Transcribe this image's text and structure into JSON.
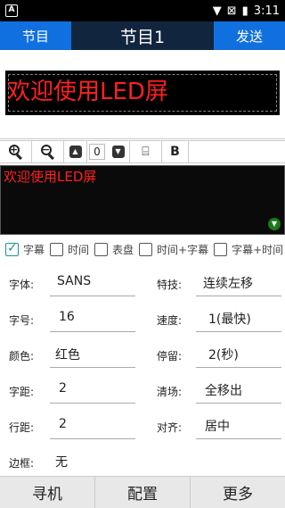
{
  "status": {
    "app_icon": "A",
    "time": "3:11"
  },
  "appbar": {
    "left_label": "节目",
    "title": "节目1",
    "right_label": "发送"
  },
  "preview": {
    "text": "欢迎使用LED屏",
    "text_color": "#ff2020"
  },
  "toolbar": {
    "number_value": "0",
    "bold_label": "B"
  },
  "editor": {
    "text": "欢迎使用LED屏"
  },
  "checkboxes": [
    {
      "label": "字幕",
      "checked": true
    },
    {
      "label": "时间",
      "checked": false
    },
    {
      "label": "表盘",
      "checked": false
    },
    {
      "label": "时间+字幕",
      "checked": false
    },
    {
      "label": "字幕+时间",
      "checked": false
    }
  ],
  "settings": {
    "font": {
      "label": "字体:",
      "value": "SANS"
    },
    "size": {
      "label": "字号:",
      "value": "16"
    },
    "color": {
      "label": "颜色:",
      "value": "红色"
    },
    "char_spacing": {
      "label": "字距:",
      "value": "2"
    },
    "line_spacing": {
      "label": "行距:",
      "value": "2"
    },
    "border": {
      "label": "边框:",
      "value": "无"
    },
    "effect": {
      "label": "特技:",
      "value": "连续左移"
    },
    "speed": {
      "label": "速度:",
      "value": "1(最快)"
    },
    "stay": {
      "label": "停留:",
      "value": "2(秒)"
    },
    "clear": {
      "label": "清场:",
      "value": "全移出"
    },
    "align": {
      "label": "对齐:",
      "value": "居中"
    }
  },
  "bottombar": {
    "find": "寻机",
    "config": "配置",
    "more": "更多"
  }
}
